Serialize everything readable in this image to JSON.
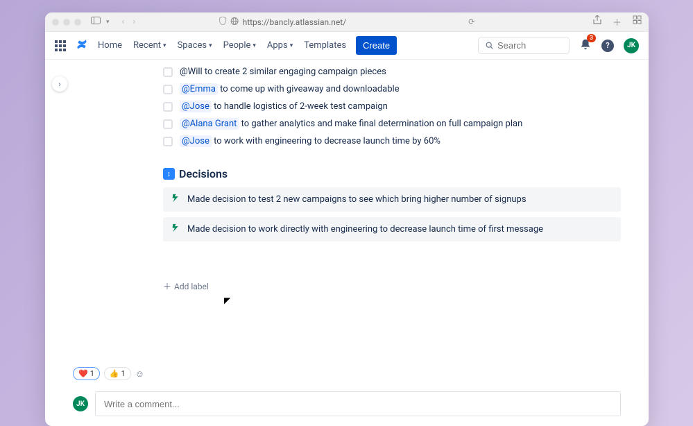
{
  "browser": {
    "url": "https://bancly.atlassian.net/"
  },
  "nav": {
    "home": "Home",
    "recent": "Recent",
    "spaces": "Spaces",
    "people": "People",
    "apps": "Apps",
    "templates": "Templates",
    "create": "Create",
    "search_placeholder": "Search",
    "notif_count": "3",
    "avatar_initials": "JK"
  },
  "actions": [
    {
      "mention": "@Will",
      "text": " to create 2 similar engaging campaign pieces",
      "plain_mention": true
    },
    {
      "mention": "@Emma",
      "text": " to come up with giveaway and downloadable"
    },
    {
      "mention": "@Jose",
      "text": " to handle logistics of 2-week test campaign"
    },
    {
      "mention": "@Alana Grant",
      "text": " to gather analytics and make final determination on full campaign plan"
    },
    {
      "mention": "@Jose",
      "text": " to work with engineering to decrease launch time by 60%"
    }
  ],
  "decisions_header": "Decisions",
  "decisions": [
    "Made decision to test 2 new campaigns to see which bring higher number of signups",
    "Made decision to work directly with engineering to decrease launch time of first message"
  ],
  "add_label": "Add label",
  "reactions": {
    "heart_count": "1",
    "thumbs_count": "1"
  },
  "comment_placeholder": "Write a comment...",
  "comment_avatar": "JK"
}
